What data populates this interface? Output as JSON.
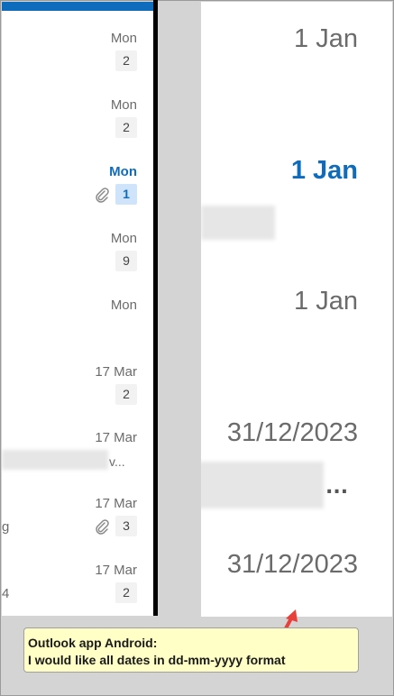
{
  "left_list": {
    "rows": [
      {
        "date": "Mon",
        "count": "2",
        "snippet": "",
        "attachment": false,
        "unread": false
      },
      {
        "date": "Mon",
        "count": "2",
        "snippet": "",
        "attachment": false,
        "unread": false
      },
      {
        "date": "Mon",
        "count": "1",
        "snippet": "",
        "attachment": true,
        "unread": true
      },
      {
        "date": "Mon",
        "count": "9",
        "snippet": "",
        "attachment": false,
        "unread": false
      },
      {
        "date": "Mon",
        "count": "",
        "snippet": "",
        "attachment": false,
        "unread": false
      },
      {
        "date": "17 Mar",
        "count": "2",
        "snippet": "",
        "attachment": false,
        "unread": false
      },
      {
        "date": "17 Mar",
        "count": "",
        "snippet": "v...",
        "attachment": false,
        "unread": false
      },
      {
        "date": "17 Mar",
        "count": "3",
        "snippet": "g",
        "attachment": true,
        "unread": false
      },
      {
        "date": "17 Mar",
        "count": "2",
        "snippet": "4",
        "attachment": false,
        "unread": false
      }
    ]
  },
  "right_list": {
    "dates": [
      {
        "text": "1 Jan",
        "unread": false
      },
      {
        "text": "1 Jan",
        "unread": true
      },
      {
        "text": "1 Jan",
        "unread": false
      },
      {
        "text": "31/12/2023",
        "unread": false
      },
      {
        "text": "31/12/2023",
        "unread": false
      }
    ],
    "ellipsis": "..."
  },
  "callout": {
    "line1": "Outlook app Android:",
    "line2": "I would like all dates in dd-mm-yyyy format"
  },
  "colors": {
    "accent": "#0f6cbd",
    "callout_bg": "#ffffc6",
    "arrow": "#e8413c"
  }
}
